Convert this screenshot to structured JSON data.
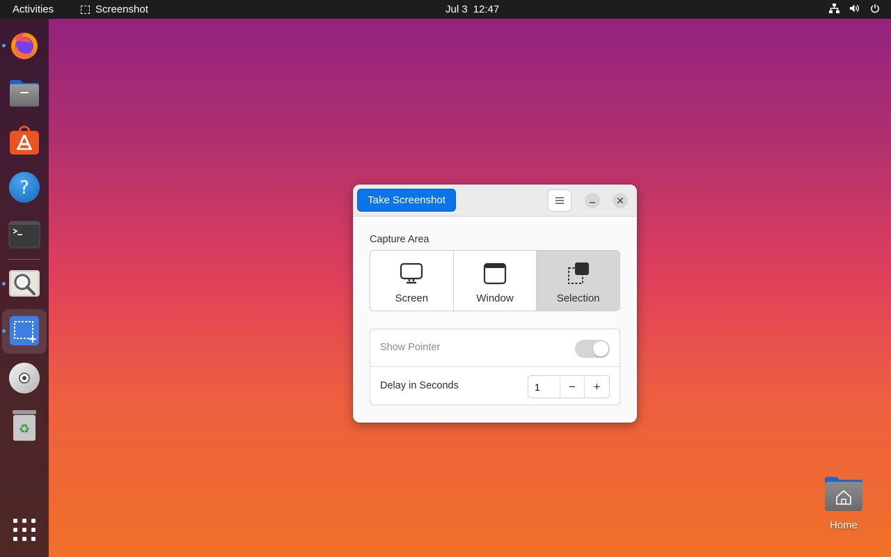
{
  "topbar": {
    "activities": "Activities",
    "app_name": "Screenshot",
    "date": "Jul 3",
    "time": "12:47",
    "tray_icons": [
      "network-icon",
      "volume-icon",
      "power-icon"
    ]
  },
  "dock": {
    "items": [
      {
        "name": "firefox",
        "running": true
      },
      {
        "name": "files",
        "running": false
      },
      {
        "name": "app-center",
        "running": false
      },
      {
        "name": "help",
        "running": false
      },
      {
        "name": "terminal",
        "running": false
      },
      {
        "name": "image-viewer",
        "running": true
      },
      {
        "name": "screenshot",
        "running": true,
        "active": true
      },
      {
        "name": "disc",
        "running": false
      },
      {
        "name": "trash",
        "running": false
      },
      {
        "name": "show-apps",
        "running": false
      }
    ]
  },
  "desktop": {
    "home_label": "Home"
  },
  "dialog": {
    "take_screenshot": "Take Screenshot",
    "capture_area_label": "Capture Area",
    "options": [
      {
        "label": "Screen",
        "selected": false
      },
      {
        "label": "Window",
        "selected": false
      },
      {
        "label": "Selection",
        "selected": true
      }
    ],
    "show_pointer_label": "Show Pointer",
    "show_pointer_enabled": false,
    "delay_label": "Delay in Seconds",
    "delay_value": "1",
    "minus": "−",
    "plus": "+"
  },
  "colors": {
    "accent": "#0b74e8",
    "topbar": "#1d1d1d",
    "dock": "#281824"
  }
}
